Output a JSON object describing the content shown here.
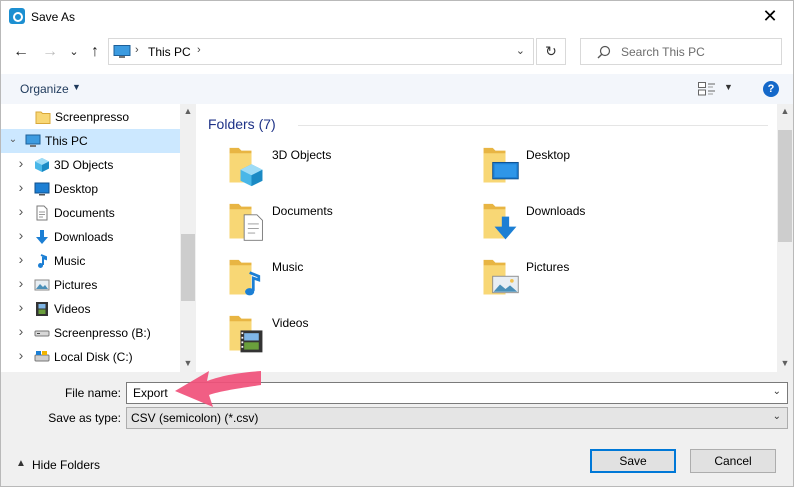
{
  "window": {
    "title": "Save As"
  },
  "nav": {
    "address_segment": "This PC",
    "search_placeholder": "Search This PC"
  },
  "toolbar": {
    "organize_label": "Organize"
  },
  "sidebar": {
    "items": [
      {
        "label": "Screenpresso",
        "icon": "folder-icon",
        "chevron": "",
        "selected": false
      },
      {
        "label": "This PC",
        "icon": "computer-icon",
        "chevron": "down",
        "selected": true
      },
      {
        "label": "3D Objects",
        "icon": "cube-icon",
        "chevron": "right",
        "selected": false
      },
      {
        "label": "Desktop",
        "icon": "desktop-icon",
        "chevron": "right",
        "selected": false
      },
      {
        "label": "Documents",
        "icon": "document-icon",
        "chevron": "right",
        "selected": false
      },
      {
        "label": "Downloads",
        "icon": "download-icon",
        "chevron": "right",
        "selected": false
      },
      {
        "label": "Music",
        "icon": "music-icon",
        "chevron": "right",
        "selected": false
      },
      {
        "label": "Pictures",
        "icon": "picture-icon",
        "chevron": "right",
        "selected": false
      },
      {
        "label": "Videos",
        "icon": "video-icon",
        "chevron": "right",
        "selected": false
      },
      {
        "label": "Screenpresso (B:)",
        "icon": "drive-icon",
        "chevron": "right",
        "selected": false
      },
      {
        "label": "Local Disk (C:)",
        "icon": "disk-icon",
        "chevron": "right",
        "selected": false
      }
    ]
  },
  "main": {
    "group_header": "Folders (7)",
    "folders": [
      {
        "label": "3D Objects",
        "overlay": "cube"
      },
      {
        "label": "Desktop",
        "overlay": "desktop"
      },
      {
        "label": "Documents",
        "overlay": "document"
      },
      {
        "label": "Downloads",
        "overlay": "download"
      },
      {
        "label": "Music",
        "overlay": "music"
      },
      {
        "label": "Pictures",
        "overlay": "picture"
      },
      {
        "label": "Videos",
        "overlay": "video"
      }
    ]
  },
  "form": {
    "filename_label": "File name:",
    "filename_value": "Export",
    "filetype_label": "Save as type:",
    "filetype_value": "CSV (semicolon) (*.csv)"
  },
  "footer": {
    "hide_folders_label": "Hide Folders",
    "save_label": "Save",
    "cancel_label": "Cancel"
  },
  "colors": {
    "accent": "#0078d7",
    "selection": "#cce8ff",
    "annotation_arrow": "#f0507a",
    "group_header": "#1e3287"
  }
}
